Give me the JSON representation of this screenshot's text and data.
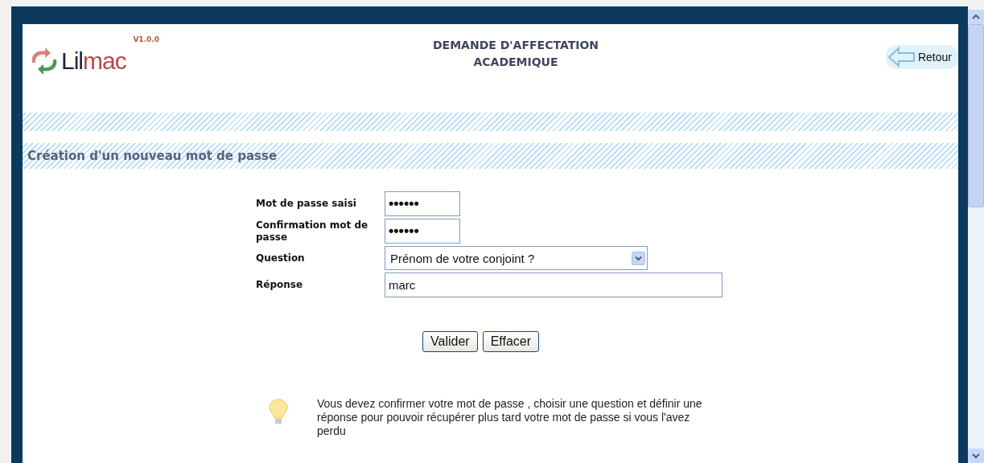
{
  "header": {
    "version": "V1.0.0",
    "logo": {
      "part_1": "Lil",
      "part_2": "mac"
    },
    "title_lines": [
      "DEMANDE D'AFFECTATION",
      "ACADEMIQUE"
    ],
    "back_button": "Retour"
  },
  "section_title": "Création d'un nouveau mot de passe",
  "form": {
    "fields": [
      {
        "kind": "password",
        "label": "Mot de passe saisi",
        "value": "••••••"
      },
      {
        "kind": "password",
        "label": "Confirmation mot de passe",
        "value": "••••••"
      },
      {
        "kind": "select",
        "label": "Question",
        "value": "Prénom de votre conjoint ?"
      },
      {
        "kind": "text",
        "label": "Réponse",
        "value": "marc"
      }
    ],
    "buttons": [
      "Valider",
      "Effacer"
    ]
  },
  "hint": "Vous devez confirmer votre mot de passe , choisir une question et définir une réponse pour pouvoir récupérer plus tard votre mot de passe si vous l'avez perdu"
}
